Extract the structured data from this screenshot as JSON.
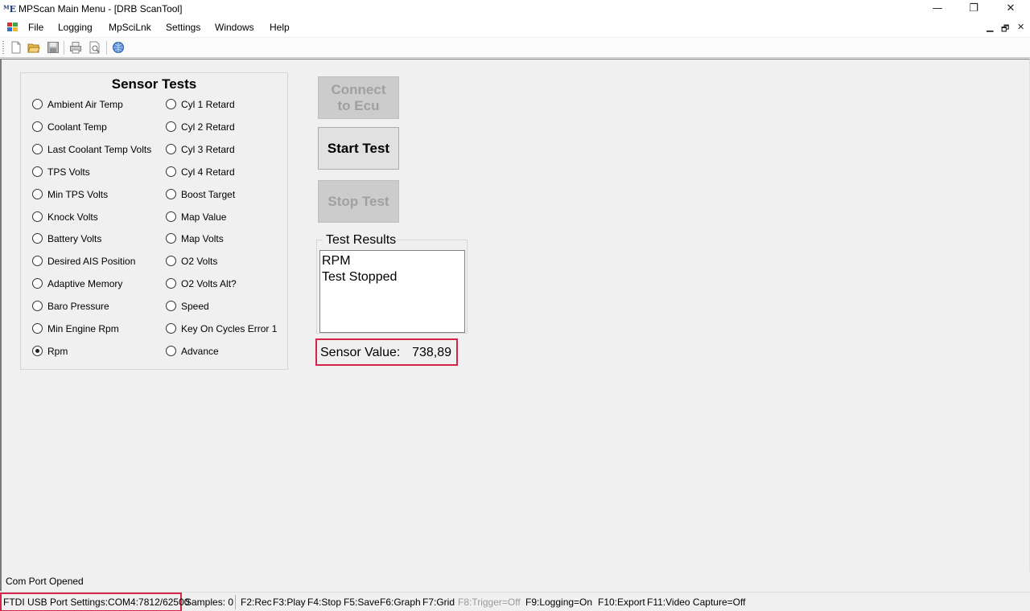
{
  "window": {
    "title": "MPScan Main Menu - [DRB ScanTool]",
    "icon_text": "ᴹE",
    "minimize": "—",
    "restore": "❐",
    "close": "✕"
  },
  "menu": {
    "items": [
      "File",
      "Logging",
      "MpSciLnk",
      "Settings",
      "Windows",
      "Help"
    ],
    "mdi_minimize": "▁",
    "mdi_restore": "🗗",
    "mdi_close": "✕"
  },
  "sensor_tests": {
    "title": "Sensor Tests",
    "left": [
      "Ambient Air Temp",
      "Coolant Temp",
      "Last Coolant Temp Volts",
      "TPS Volts",
      "Min TPS Volts",
      "Knock Volts",
      "Battery Volts",
      "Desired AIS Position",
      "Adaptive Memory",
      "Baro Pressure",
      "Min Engine Rpm",
      "Rpm"
    ],
    "right": [
      "Cyl 1 Retard",
      "Cyl 2 Retard",
      "Cyl 3 Retard",
      "Cyl 4 Retard",
      "Boost Target",
      "Map Value",
      "Map Volts",
      "O2 Volts",
      "O2 Volts Alt?",
      "Speed",
      "Key On Cycles Error 1",
      "Advance"
    ],
    "selected": "Rpm"
  },
  "buttons": {
    "connect_line1": "Connect",
    "connect_line2": "to Ecu",
    "start": "Start Test",
    "stop": "Stop Test"
  },
  "results": {
    "title": "Test Results",
    "lines": [
      "RPM",
      "Test Stopped"
    ]
  },
  "sensor_value": {
    "label": "Sensor Value:",
    "value": "738,89"
  },
  "status": {
    "message": "Com Port Opened",
    "port": "FTDI USB Port Settings:COM4:7812/62500",
    "samples": "Samples: 0",
    "keys": [
      {
        "text": "F2:Rec",
        "enabled": true
      },
      {
        "text": "F3:Play",
        "enabled": true
      },
      {
        "text": "F4:Stop",
        "enabled": true
      },
      {
        "text": "F5:Save",
        "enabled": true
      },
      {
        "text": "F6:Graph",
        "enabled": true
      },
      {
        "text": "F7:Grid",
        "enabled": true
      },
      {
        "text": "F8:Trigger=Off",
        "enabled": false
      },
      {
        "text": "F9:Logging=On",
        "enabled": true
      },
      {
        "text": "F10:Export",
        "enabled": true
      },
      {
        "text": "F11:Video Capture=Off",
        "enabled": true
      }
    ]
  },
  "toolbar": {
    "icons": [
      "new-file-icon",
      "open-folder-icon",
      "save-disk-icon",
      "print-icon",
      "print-preview-icon",
      "help-globe-icon"
    ]
  }
}
